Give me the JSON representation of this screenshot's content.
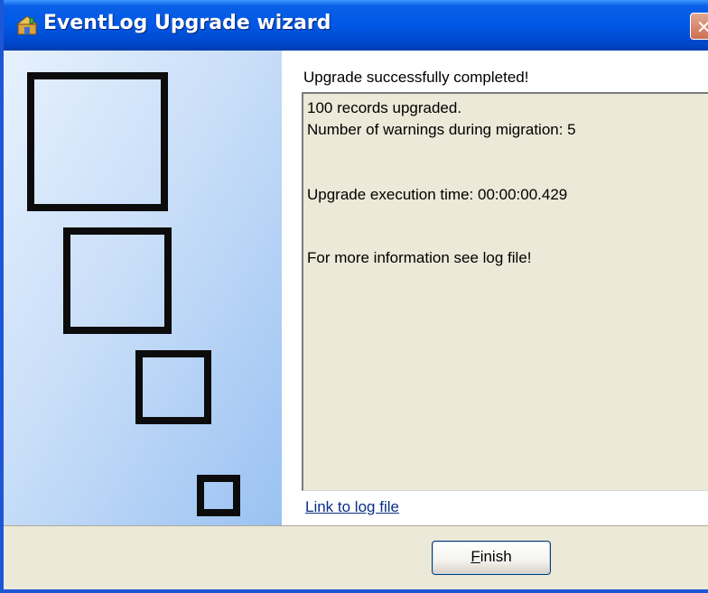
{
  "window": {
    "title": "EventLog Upgrade wizard",
    "title_icon": "upgrade-wizard-icon",
    "close_glyph": "✕",
    "titlebar_color": "#0058e6"
  },
  "main": {
    "status_heading": "Upgrade successfully completed!",
    "log_lines": [
      "100 records upgraded.",
      "Number of warnings during migration: 5",
      "Upgrade execution time: 00:00:00.429",
      "For more information see log file!"
    ],
    "log_link": "Link to log file"
  },
  "footer": {
    "finish_mnemonic": "F",
    "finish_rest": "inish"
  }
}
